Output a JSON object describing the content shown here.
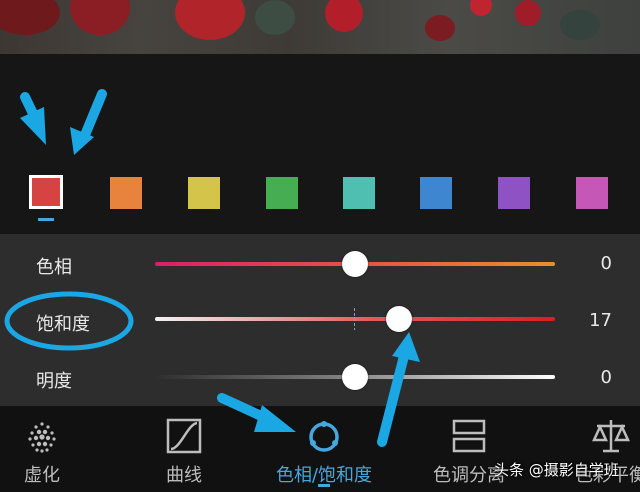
{
  "photo": {
    "description_icon": "rose-photo"
  },
  "colors": {
    "accent": "#45a7e0",
    "annotation": "#1aa7e4",
    "swatches": [
      "#d64343",
      "#e8833d",
      "#d4c54a",
      "#46ad52",
      "#4fbfb2",
      "#3f86d0",
      "#8e52c4",
      "#c558b6"
    ]
  },
  "sliders": [
    {
      "label": "色相",
      "value": "0",
      "level": 0
    },
    {
      "label": "饱和度",
      "value": "17",
      "level": 17
    },
    {
      "label": "明度",
      "value": "0",
      "level": 0
    }
  ],
  "tabs": [
    {
      "label": "虚化",
      "icon": "dot-grid-icon"
    },
    {
      "label": "曲线",
      "icon": "curve-icon"
    },
    {
      "label": "色相/饱和度",
      "icon": "ring-icon",
      "active": true
    },
    {
      "label": "色调分离",
      "icon": "split-tone-icon"
    },
    {
      "label": "色彩平衡",
      "icon": "balance-scale-icon"
    }
  ],
  "watermark": "头条 @摄影自学班"
}
